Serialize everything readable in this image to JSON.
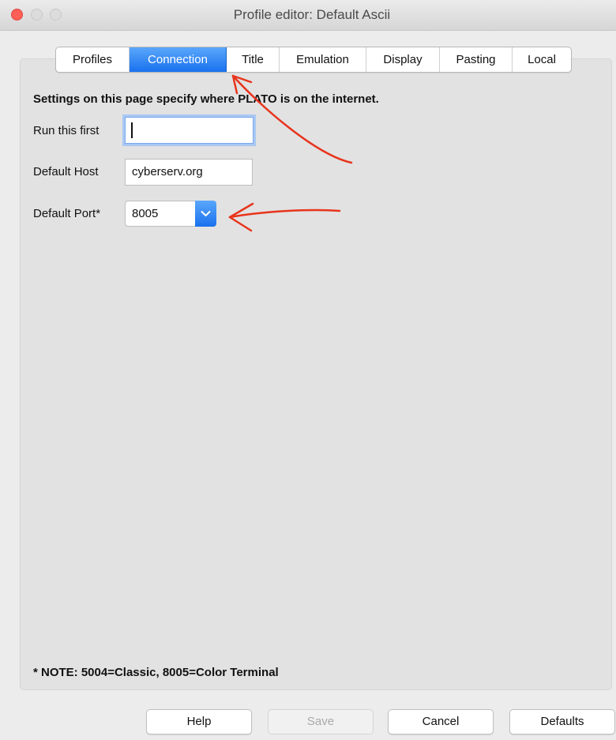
{
  "window": {
    "title": "Profile editor: Default Ascii"
  },
  "tabs": [
    {
      "label": "Profiles",
      "active": false
    },
    {
      "label": "Connection",
      "active": true
    },
    {
      "label": "Title",
      "active": false
    },
    {
      "label": "Emulation",
      "active": false
    },
    {
      "label": "Display",
      "active": false
    },
    {
      "label": "Pasting",
      "active": false
    },
    {
      "label": "Local",
      "active": false
    }
  ],
  "connection": {
    "heading": "Settings on this page specify where PLATO is on the internet.",
    "run_first_label": "Run this first",
    "run_first_value": "",
    "default_host_label": "Default Host",
    "default_host_value": "cyberserv.org",
    "default_port_label": "Default Port*",
    "default_port_value": "8005",
    "note": "* NOTE: 5004=Classic, 8005=Color Terminal"
  },
  "buttons": {
    "help": "Help",
    "save": "Save",
    "cancel": "Cancel",
    "defaults": "Defaults"
  },
  "icons": {
    "close": "close-traffic-light",
    "minimize": "minimize-traffic-light",
    "maximize": "maximize-traffic-light",
    "dropdown": "chevron-down-icon"
  },
  "colors": {
    "accent": "#1971ee",
    "annotation": "#e8341c",
    "close_button": "#fe5f57"
  }
}
